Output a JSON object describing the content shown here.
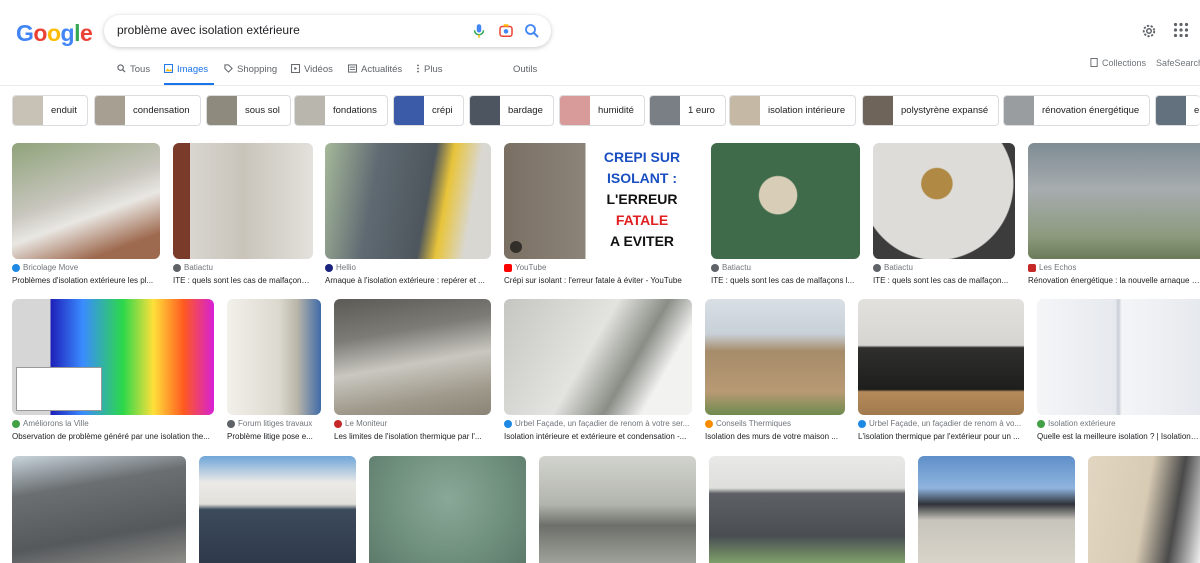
{
  "search": {
    "query": "problème avec isolation extérieure"
  },
  "logo": [
    "G",
    "o",
    "o",
    "g",
    "l",
    "e"
  ],
  "tabs": [
    {
      "label": "Tous",
      "icon": "search-icon"
    },
    {
      "label": "Images",
      "icon": "image-icon"
    },
    {
      "label": "Shopping",
      "icon": "tag-icon"
    },
    {
      "label": "Vidéos",
      "icon": "play-icon"
    },
    {
      "label": "Actualités",
      "icon": "news-icon"
    },
    {
      "label": "Plus",
      "icon": "more-vert-icon"
    },
    {
      "label": "Outils"
    }
  ],
  "right_links": {
    "collections": "Collections",
    "safesearch": "SafeSearch"
  },
  "chips": [
    {
      "label": "enduit",
      "color": "#c8c2b6"
    },
    {
      "label": "condensation",
      "color": "#a69f92"
    },
    {
      "label": "sous sol",
      "color": "#8e8a7d"
    },
    {
      "label": "fondations",
      "color": "#b9b6ae"
    },
    {
      "label": "crépi",
      "color": "#3b5aa8"
    },
    {
      "label": "bardage",
      "color": "#4c5560"
    },
    {
      "label": "humidité",
      "color": "#d99a9a"
    },
    {
      "label": "1 euro",
      "color": "#7a7f86"
    },
    {
      "label": "isolation intérieure",
      "color": "#c5b9a5"
    },
    {
      "label": "polystyrène expansé",
      "color": "#6e6459"
    },
    {
      "label": "rénovation énergétique",
      "color": "#9a9da0"
    },
    {
      "label": "e",
      "color": "#63707e"
    }
  ],
  "row1": [
    {
      "source": "Bricolage Move",
      "caption": "Problèmes d'isolation extérieure les pl...",
      "color": "#b9bfae",
      "fav": "#1e88e5"
    },
    {
      "source": "Batiactu",
      "caption": "ITE : quels sont les cas de malfaçons ...",
      "color": "#cfccc6",
      "fav": "#5f6368"
    },
    {
      "source": "Hellio",
      "caption": "Arnaque à l'isolation extérieure : repérer et ...",
      "color": "#8d9a84",
      "fav": "#1a237e"
    },
    {
      "source": "YouTube",
      "caption": "Crépi sur isolant : l'erreur fatale à éviter - YouTube",
      "color": "#f2f2f2",
      "fav": "#ff0000"
    },
    {
      "source": "Batiactu",
      "caption": "ITE : quels sont les cas de malfaçons l...",
      "color": "#3f6b4a",
      "fav": "#5f6368"
    },
    {
      "source": "Batiactu",
      "caption": "ITE : quels sont les cas de malfaçon...",
      "color": "#d9d9d7",
      "fav": "#5f6368"
    },
    {
      "source": "Les Echos",
      "caption": "Rénovation énergétique : la nouvelle arnaque de ...",
      "color": "#8c9196",
      "fav": "#c62828"
    }
  ],
  "row2": [
    {
      "source": "Améliorons la Ville",
      "caption": "Observation de problème généré par une isolation the...",
      "color": "#2b2bd0",
      "fav": "#43a047"
    },
    {
      "source": "Forum litiges travaux",
      "caption": "Problème litige pose e...",
      "color": "#d8d5cc",
      "fav": "#5f6368"
    },
    {
      "source": "Le Moniteur",
      "caption": "Les limites de l'isolation thermique par l'...",
      "color": "#8a8984",
      "fav": "#c62828"
    },
    {
      "source": "Urbel Façade, un façadier de renom à votre ser...",
      "caption": "Isolation intérieure et extérieure et condensation -...",
      "color": "#cfd0cc",
      "fav": "#1e88e5"
    },
    {
      "source": "Conseils Thermiques",
      "caption": "Isolation des murs de votre maison ...",
      "color": "#a68c6a",
      "fav": "#fb8c00"
    },
    {
      "source": "Urbel Façade, un façadier de renom à vo...",
      "caption": "L'isolation thermique par l'extérieur pour un ...",
      "color": "#3a3a38",
      "fav": "#1e88e5"
    },
    {
      "source": "Isolation extérieure",
      "caption": "Quelle est la meilleure isolation ? | Isolation ex...",
      "color": "#eef0f3",
      "fav": "#43a047"
    }
  ],
  "row3": [
    {
      "color": "#6b6f72"
    },
    {
      "color": "#3c4a5c"
    },
    {
      "color": "#7e9a8a"
    },
    {
      "color": "#b2b5ad"
    },
    {
      "color": "#5f7f99"
    },
    {
      "color": "#c7c4bb"
    },
    {
      "color": "#d8cbb4"
    }
  ],
  "video_thumb_text": [
    "CREPI SUR",
    "ISOLANT :",
    "L'ERREUR",
    "FATALE",
    "A EVITER"
  ]
}
